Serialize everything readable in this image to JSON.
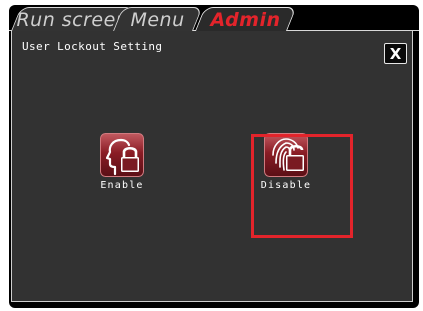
{
  "tabs": [
    {
      "label": "Run screen"
    },
    {
      "label": "Menu"
    },
    {
      "label": "Admin",
      "active": true
    }
  ],
  "panel": {
    "title": "User Lockout Setting",
    "close_label": "X"
  },
  "options": {
    "enable": {
      "label": "Enable",
      "icon": "head-padlock-icon"
    },
    "disable": {
      "label": "Disable",
      "icon": "fingerprint-padlock-icon",
      "selected": true
    }
  },
  "colors": {
    "accent": "#e3242b",
    "screen_bg": "#000000",
    "panel_bg": "#323232",
    "icon_bg": "#7a1a22"
  }
}
